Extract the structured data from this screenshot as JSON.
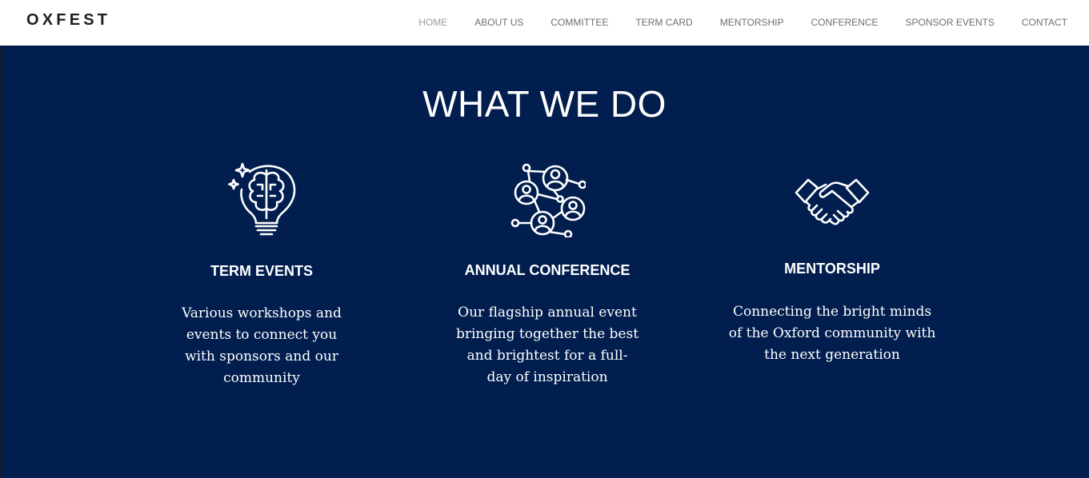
{
  "brand": {
    "logo": "OXFEST"
  },
  "nav": {
    "items": [
      {
        "label": "HOME"
      },
      {
        "label": "ABOUT US"
      },
      {
        "label": "COMMITTEE"
      },
      {
        "label": "TERM CARD"
      },
      {
        "label": "MENTORSHIP"
      },
      {
        "label": "CONFERENCE"
      },
      {
        "label": "SPONSOR EVENTS"
      },
      {
        "label": "CONTACT"
      }
    ],
    "active": "HOME"
  },
  "section": {
    "title": "WHAT WE DO"
  },
  "cards": [
    {
      "icon": "lightbulb-brain-icon",
      "title": "TERM EVENTS",
      "description": "Various workshops and events to connect you with sponsors and our community"
    },
    {
      "icon": "people-network-icon",
      "title": "ANNUAL CONFERENCE",
      "description": "Our flagship annual event bringing together the best and brightest for a full-day of inspiration"
    },
    {
      "icon": "handshake-icon",
      "title": "MENTORSHIP",
      "description": "Connecting the bright minds of the Oxford community with the next generation"
    }
  ],
  "colors": {
    "hero_background": "#011e4e",
    "nav_text": "#6e6e6e",
    "logo_text": "#1f1f1f",
    "foreground": "#ffffff"
  }
}
